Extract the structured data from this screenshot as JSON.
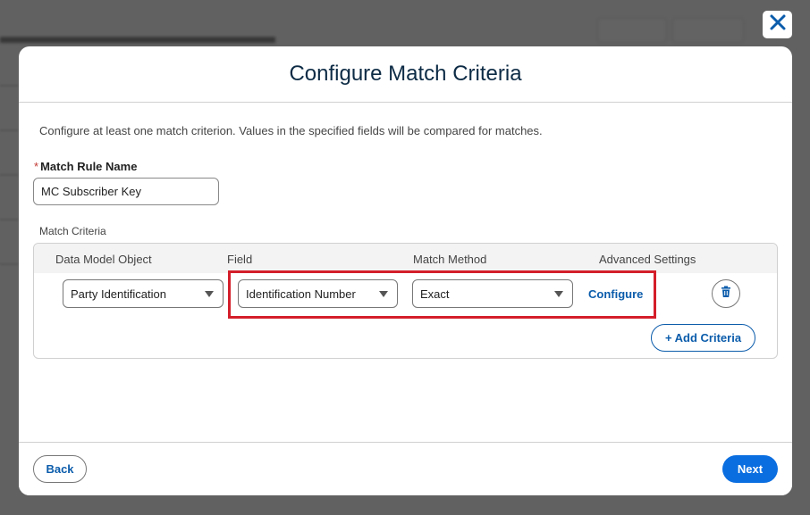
{
  "modal": {
    "title": "Configure Match Criteria",
    "intro": "Configure at least one match criterion. Values in the specified fields will be compared for matches."
  },
  "match_rule": {
    "label": "Match Rule Name",
    "required_marker": "*",
    "value": "MC Subscriber Key"
  },
  "criteria": {
    "section_label": "Match Criteria",
    "columns": [
      "Data Model Object",
      "Field",
      "Match Method",
      "Advanced Settings"
    ],
    "row": {
      "data_model_object": "Party Identification",
      "field": "Identification Number",
      "match_method": "Exact",
      "advanced_settings_link": "Configure"
    },
    "add_button": "+ Add Criteria"
  },
  "footer": {
    "back": "Back",
    "next": "Next"
  },
  "colors": {
    "brand_blue": "#0b5cab",
    "primary_button": "#0b6ee0",
    "highlight": "#d41e2a",
    "required": "#c23934"
  },
  "icons": {
    "close": "close-icon",
    "delete": "trash-icon",
    "dropdown": "chevron-down-icon"
  }
}
